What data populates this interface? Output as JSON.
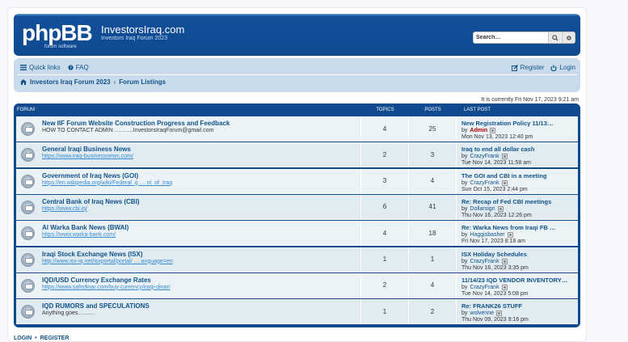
{
  "header": {
    "logo_text": "phpBB",
    "logo_sub": "forum software",
    "site_title": "InvestorsIraq.com",
    "site_desc": "Investors Iraq Forum 2023"
  },
  "search": {
    "placeholder": "Search…"
  },
  "nav": {
    "quick_links": "Quick links",
    "faq": "FAQ",
    "register": "Register",
    "login": "Login",
    "crumb_home": "Investors Iraq Forum 2023",
    "crumb_sep": "‹",
    "crumb_current": "Forum Listings"
  },
  "time": "It is currently Fri Nov 17, 2023 9:21 am",
  "table_headers": {
    "forum": "Forum",
    "topics": "Topics",
    "posts": "Posts",
    "last_post": "Last post"
  },
  "forums": [
    {
      "title": "New IIF Forum Website Construction Progress and Feedback",
      "desc": "HOW TO CONTACT ADMIN ……….InvestorsIraqForum@gmail.com",
      "desc_link": false,
      "topics": "4",
      "posts": "25",
      "lp_title": "New Registration Policy 11/13…",
      "lp_by": "by",
      "lp_user": "Admin",
      "lp_admin": true,
      "lp_date": "Mon Nov 13, 2023 12:40 pm"
    },
    {
      "title": "General Iraqi Business News",
      "desc": "https://www.iraq-businessnews.com/",
      "desc_link": true,
      "topics": "2",
      "posts": "3",
      "lp_title": "Iraq to end all dollar cash",
      "lp_by": "by",
      "lp_user": "CrazyFrank",
      "lp_admin": false,
      "lp_date": "Tue Nov 14, 2023 11:58 am"
    },
    {
      "title": "Government of Iraq News (GOI)",
      "desc": "https://en.wikipedia.org/wiki/Federal_g … nt_of_Iraq",
      "desc_link": true,
      "topics": "3",
      "posts": "4",
      "lp_title": "The GOI and CBI in a meeting",
      "lp_by": "by",
      "lp_user": "CrazyFrank",
      "lp_admin": false,
      "lp_date": "Sun Oct 15, 2023 2:44 pm"
    },
    {
      "title": "Central Bank of Iraq News (CBI)",
      "desc": "https://www.cbi.iq/",
      "desc_link": true,
      "topics": "6",
      "posts": "41",
      "lp_title": "Re: Recap of Fed CBI meetings",
      "lp_by": "by",
      "lp_user": "Dollarsign",
      "lp_admin": false,
      "lp_date": "Thu Nov 16, 2023 12:26 pm"
    },
    {
      "title": "Al Warka Bank News (BWAI)",
      "desc": "https://www.warka-bank.com/",
      "desc_link": true,
      "topics": "4",
      "posts": "18",
      "lp_title": "Re: Warka News from Iraqi FB …",
      "lp_by": "by",
      "lp_user": "Haggisbasher",
      "lp_admin": false,
      "lp_date": "Fri Nov 17, 2023 8:18 am"
    },
    {
      "title": "Iraqi Stock Exchange News (ISX)",
      "desc": "http://www.isx-iq.net/isxportal/portal/ … anguage=en",
      "desc_link": true,
      "topics": "1",
      "posts": "1",
      "lp_title": "ISX Holiday Schedules",
      "lp_by": "by",
      "lp_user": "CrazyFrank",
      "lp_admin": false,
      "lp_date": "Thu Nov 16, 2023 3:35 pm"
    },
    {
      "title": "IQD/USD Currency Exchange Rates",
      "desc": "https://www.safedinar.com/buy-currency/iraqi-dinar/",
      "desc_link": true,
      "topics": "2",
      "posts": "4",
      "lp_title": "11/14/23 IQD VENDOR INVENTORY…",
      "lp_by": "by",
      "lp_user": "CrazyFrank",
      "lp_admin": false,
      "lp_date": "Tue Nov 14, 2023 5:08 pm"
    },
    {
      "title": "IQD RUMORS and SPECULATIONS",
      "desc": "Anything goes………",
      "desc_link": false,
      "topics": "1",
      "posts": "2",
      "lp_title": "Re: FRANK26 STUFF",
      "lp_by": "by",
      "lp_user": "wolverine",
      "lp_admin": false,
      "lp_date": "Thu Nov 09, 2023 9:16 pm"
    }
  ],
  "bottom": {
    "login": "LOGIN",
    "sep": "•",
    "register": "REGISTER"
  }
}
